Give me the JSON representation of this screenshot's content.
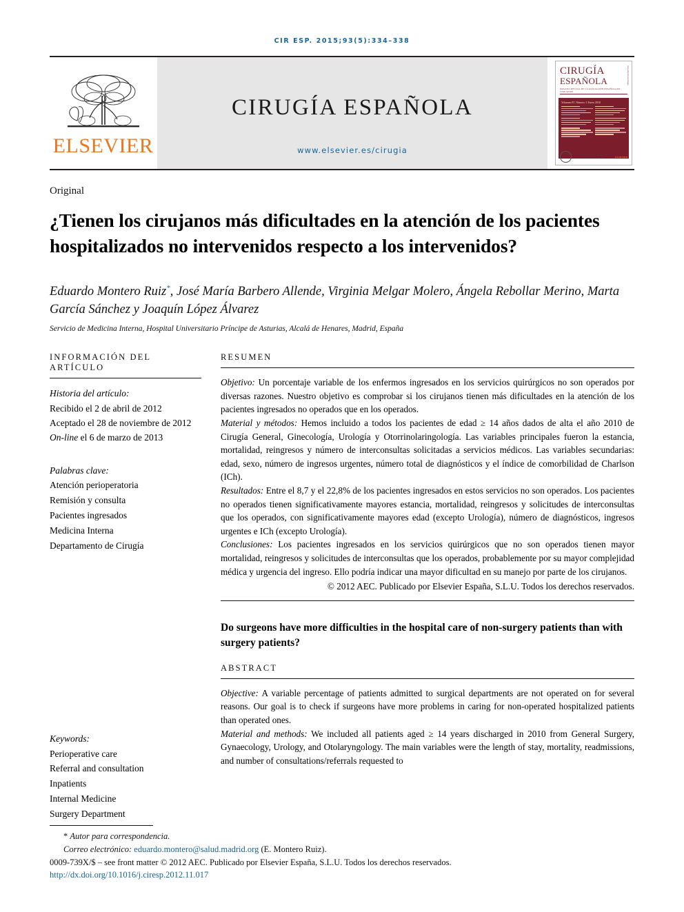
{
  "running_head": "CIR ESP. 2015;93(5):334–338",
  "masthead": {
    "publisher_logo_label": "ELSEVIER",
    "journal_name": "CIRUGÍA ESPAÑOLA",
    "journal_url": "www.elsevier.es/cirugia",
    "cover": {
      "line1": "CIRUGÍA",
      "line2": "ESPAÑOLA",
      "subtitle": "ÓRGANO OFICIAL DE LA ASOCIACIÓN ESPAÑOLA DE CIRUJANOS",
      "volume_line": "Volumen 87, Número 1  Enero 2010",
      "spine": "www.elsevier.es/cirugia",
      "footer_text": "Publicado por Elsevier España, S.L.U. www.elsevier.es/cirugia",
      "publisher_mark": "ELSEVIER"
    }
  },
  "article": {
    "type": "Original",
    "title": "¿Tienen los cirujanos más dificultades en la atención de los pacientes hospitalizados no intervenidos respecto a los intervenidos?",
    "authors": "Eduardo Montero Ruiz",
    "authors_rest": ", José María Barbero Allende, Virginia Melgar Molero, Ángela Rebollar Merino, Marta García Sánchez y Joaquín López Álvarez",
    "corresponding_marker": "*",
    "affiliation": "Servicio de Medicina Interna, Hospital Universitario Príncipe de Asturias, Alcalá de Henares, Madrid, España"
  },
  "info_section": {
    "heading": "INFORMACIÓN DEL ARTÍCULO",
    "history_label": "Historia del artículo:",
    "history": [
      "Recibido el 2 de abril de 2012",
      "Aceptado el 28 de noviembre de 2012"
    ],
    "online_prefix": "On-line",
    "online_rest": " el 6 de marzo de 2013",
    "keywords_label": "Palabras clave:",
    "keywords": [
      "Atención perioperatoria",
      "Remisión y consulta",
      "Pacientes ingresados",
      "Medicina Interna",
      "Departamento de Cirugía"
    ],
    "keywords_en_label": "Keywords:",
    "keywords_en": [
      "Perioperative care",
      "Referral and consultation",
      "Inpatients",
      "Internal Medicine",
      "Surgery Department"
    ]
  },
  "abstract_es": {
    "heading": "RESUMEN",
    "objetivo_label": "Objetivo:",
    "objetivo_text": " Un porcentaje variable de los enfermos ingresados en los servicios quirúrgicos no son operados por diversas razones. Nuestro objetivo es comprobar si los cirujanos tienen más dificultades en la atención de los pacientes ingresados no operados que en los operados.",
    "metodos_label": "Material y métodos:",
    "metodos_text": " Hemos incluido a todos los pacientes de edad ≥ 14 años dados de alta el año 2010 de Cirugía General, Ginecología, Urología y Otorrinolaringología. Las variables principales fueron la estancia, mortalidad, reingresos y número de interconsultas solicitadas a servicios médicos. Las variables secundarias: edad, sexo, número de ingresos urgentes, número total de diagnósticos y el índice de comorbilidad de Charlson (ICh).",
    "resultados_label": "Resultados:",
    "resultados_text": " Entre el 8,7 y el 22,8% de los pacientes ingresados en estos servicios no son operados. Los pacientes no operados tienen significativamente mayores estancia, mortalidad, reingresos y solicitudes de interconsultas que los operados, con significativamente mayores edad (excepto Urología), número de diagnósticos, ingresos urgentes e ICh (excepto Urología).",
    "conclusiones_label": "Conclusiones:",
    "conclusiones_text": " Los pacientes ingresados en los servicios quirúrgicos que no son operados tienen mayor mortalidad, reingresos y solicitudes de interconsultas que los operados, probablemente por su mayor complejidad médica y urgencia del ingreso. Ello podría indicar una mayor dificultad en su manejo por parte de los cirujanos.",
    "copyright": "© 2012 AEC. Publicado por Elsevier España, S.L.U. Todos los derechos reservados."
  },
  "abstract_en": {
    "title": "Do surgeons have more difficulties in the hospital care of non-surgery patients than with surgery patients?",
    "heading": "ABSTRACT",
    "objective_label": "Objective:",
    "objective_text": " A variable percentage of patients admitted to surgical departments are not operated on for several reasons. Our goal is to check if surgeons have more problems in caring for non-operated hospitalized patients than operated ones.",
    "methods_label": "Material and methods:",
    "methods_text": " We included all patients aged ≥ 14 years discharged in 2010 from General Surgery, Gynaecology, Urology, and Otolaryngology. The main variables were the length of stay, mortality, readmissions, and number of consultations/referrals requested to"
  },
  "footer": {
    "corresponding_marker": "*",
    "corresponding_text": "Autor para correspondencia.",
    "email_label": "Correo electrónico:",
    "email": "eduardo.montero@salud.madrid.org",
    "email_suffix": "(E. Montero Ruiz).",
    "issn_line": "0009-739X/$ – see front matter © 2012 AEC. Publicado por Elsevier España, S.L.U. Todos los derechos reservados.",
    "doi": "http://dx.doi.org/10.1016/j.ciresp.2012.11.017"
  },
  "colors": {
    "link_blue": "#1a6496",
    "elsevier_orange": "#e87722",
    "cover_maroon": "#7b1d2b",
    "masthead_grey": "#e6e6e6"
  }
}
